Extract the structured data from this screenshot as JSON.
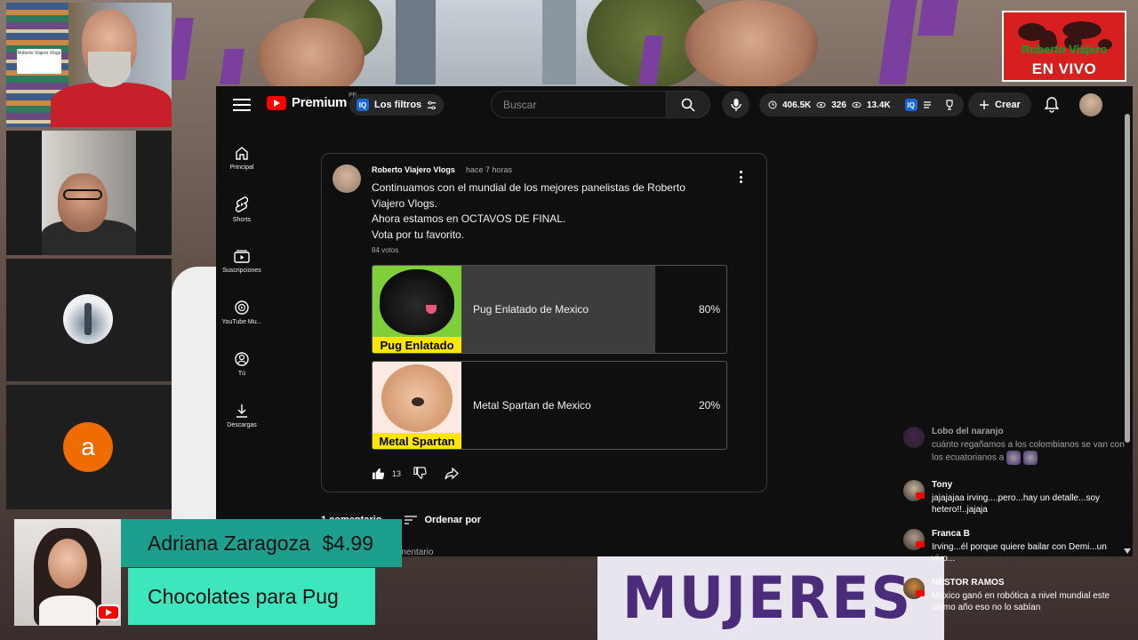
{
  "topbar": {
    "logo_text": "Premium",
    "logo_country": "PE",
    "filters_label": "Los filtros",
    "search_placeholder": "Buscar",
    "stats": {
      "views": "406.5K",
      "watching": "326",
      "likes": "13.4K"
    },
    "create_label": "Crear"
  },
  "sidebar": {
    "items": [
      {
        "label": "Principal",
        "icon": "home-icon"
      },
      {
        "label": "Shorts",
        "icon": "shorts-icon"
      },
      {
        "label": "Suscripciones",
        "icon": "subscriptions-icon"
      },
      {
        "label": "YouTube Mu...",
        "icon": "youtube-music-icon"
      },
      {
        "label": "Tú",
        "icon": "you-icon"
      },
      {
        "label": "Descargas",
        "icon": "download-icon"
      }
    ]
  },
  "post": {
    "author": "Roberto Viajero Vlogs",
    "time": "hace 7 horas",
    "text_lines": [
      "Continuamos con el mundial de los mejores panelistas de Roberto",
      "Viajero Vlogs.",
      "Ahora estamos en OCTAVOS DE FINAL.",
      "Vota por tu favorito."
    ],
    "votes": "84 votos",
    "options": [
      {
        "label": "Pug Enlatado de Mexico",
        "percent_text": "80%",
        "fraction": 0.8,
        "image_caption": "Pug Enlatado"
      },
      {
        "label": "Metal Spartan de Mexico",
        "percent_text": "20%",
        "fraction": 0.2,
        "image_caption": "Metal Spartan"
      }
    ],
    "like_count": "13"
  },
  "comments": {
    "count_label": "1 comentario",
    "sort_label": "Ordenar por",
    "add_placeholder": "comentario"
  },
  "webcams": {
    "cam1_mini_text": "Roberto Viajero Vlogs",
    "cam4_initial": "a"
  },
  "brand": {
    "name": "Roberto Viajero",
    "live": "EN VIVO"
  },
  "background_sign": "MUJERES",
  "donation": {
    "name": "Adriana Zaragoza",
    "amount": "$4.99",
    "message": "Chocolates para Pug"
  },
  "chat": [
    {
      "name": "Lobo del naranjo",
      "text": "cuánto regañamos a los colombianos se van con los ecuatorianos a",
      "avatar_color": "#6a2f7a"
    },
    {
      "name": "Tony",
      "text": "jajajajaa irving....pero...hay un detalle...soy hetero!!..jajaja",
      "avatar_color": "#c9b39b"
    },
    {
      "name": "Franca B",
      "text": "Irving...él porque quiere bailar con Demi...un vivo...",
      "avatar_color": "#b89a8a"
    },
    {
      "name": "NESTOR RAMOS",
      "text": "México ganó en robótica a nivel mundial este último año eso no lo sabían",
      "avatar_color": "#d08a3a"
    }
  ],
  "colors": {
    "youtube_red": "#ff0000",
    "donation_dark": "#1d9f8e",
    "donation_light": "#3ee6be",
    "brand_red": "#d71f1f"
  }
}
